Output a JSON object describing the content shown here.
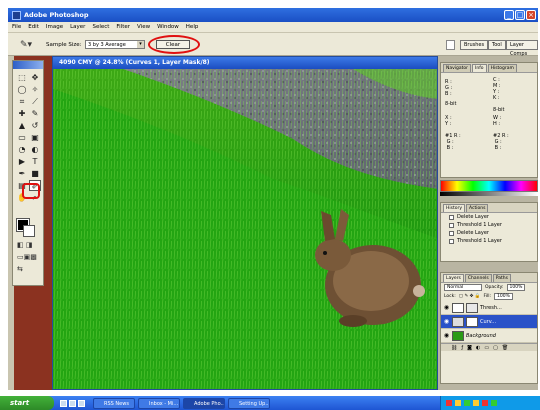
{
  "window": {
    "title": "Adobe Photoshop"
  },
  "menu": [
    "File",
    "Edit",
    "Image",
    "Layer",
    "Select",
    "Filter",
    "View",
    "Window",
    "Help"
  ],
  "options": {
    "sample_label": "Sample Size:",
    "sample_value": "3 by 3 Average",
    "clear_label": "Clear",
    "dock_tabs": [
      "Brushes",
      "Tool",
      "Layer Comps"
    ]
  },
  "document": {
    "caption": "4090 CMY @ 24.8% (Curves 1, Layer Mask/8)"
  },
  "palettes": {
    "info": {
      "tabs": [
        "Navigator",
        "Info",
        "Histogram"
      ],
      "rows": [
        {
          "left": "R :\nG :\nB :",
          "right": "C :\nM :\nY :\nK :"
        },
        {
          "left": "8-bit",
          "right": "8-bit"
        },
        {
          "left": "X :\nY :",
          "right": "W :\nH :"
        }
      ],
      "samplers": [
        {
          "left": "#1 R :\n G :\n B :",
          "right": "#2 R :\n G :\n B :"
        },
        {
          "left": "#3 R :\n G :\n B :",
          "right": "#4 R :\n G :\n B :"
        }
      ]
    },
    "history": {
      "tabs": [
        "History",
        "Actions"
      ],
      "items": [
        "Delete Layer",
        "Threshold 1 Layer",
        "Delete Layer",
        "Threshold 1 Layer"
      ]
    },
    "layers": {
      "tabs": [
        "Layers",
        "Channels",
        "Paths"
      ],
      "blend": "Normal",
      "opacity_label": "Opacity:",
      "opacity": "100%",
      "lock_label": "Lock:",
      "fill_label": "Fill:",
      "fill": "100%",
      "rows": [
        {
          "name": "Thresh..."
        },
        {
          "name": "Curv..."
        },
        {
          "name": "Background"
        }
      ]
    }
  },
  "taskbar": {
    "start": "start",
    "tasks": [
      "RSS News",
      "Inbox - Mi...",
      "Adobe Pho...",
      "Setting Up..."
    ]
  }
}
